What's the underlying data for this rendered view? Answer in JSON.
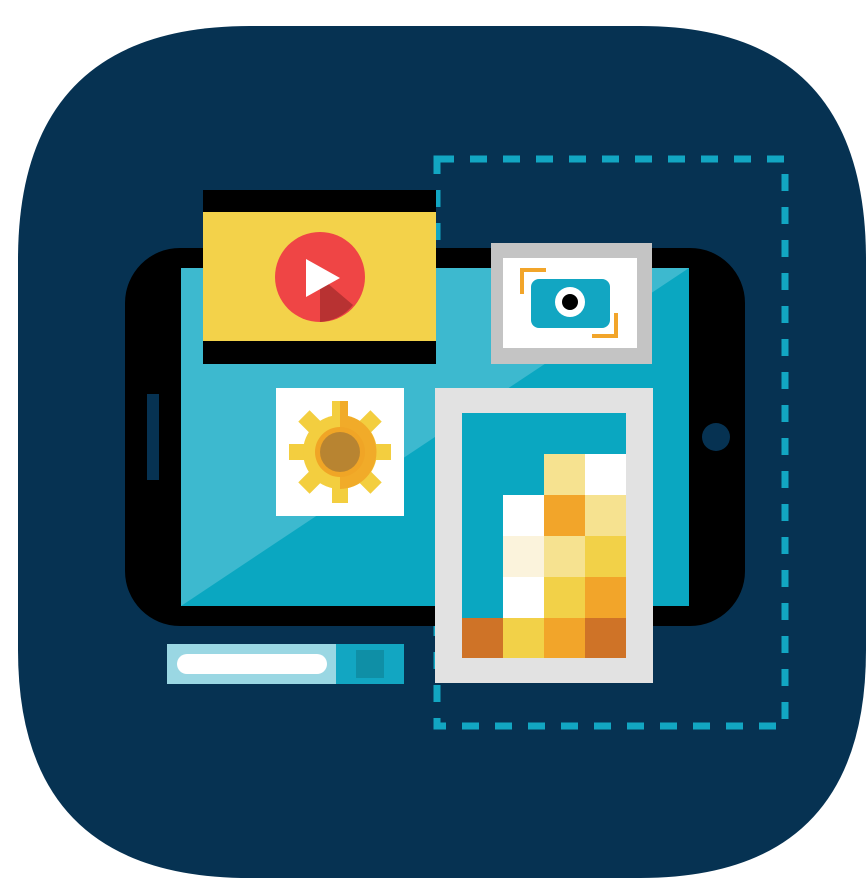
{
  "icon": {
    "name": "media-apps-tablet-app-icon",
    "elements": [
      "video-player-card",
      "play-icon",
      "camera-card",
      "camera-icon",
      "gear-icon",
      "photo-gallery-card",
      "pixel-mosaic",
      "search-bar",
      "dashed-selection-box",
      "tablet-device"
    ]
  },
  "colors": {
    "background_tile": "#063252",
    "tablet_body": "#000000",
    "screen_light": "#3db9cf",
    "screen_dark": "#0aa7c1",
    "accent_cyan": "#12a6c2",
    "video_yellow": "#f3d24a",
    "play_red": "#ef4545",
    "play_red_shadow": "#b83232",
    "camera_frame_grey": "#c4c4c4",
    "gear_light": "#f3ce3f",
    "gear_dark": "#f0a526",
    "gear_hub": "#b88431",
    "photo_frame": "#e2e2e2",
    "mosaic_orange": "#cf7327",
    "mosaic_amber": "#f2a52a",
    "mosaic_yellow": "#f2d148",
    "mosaic_pale": "#f6e290",
    "mosaic_cream": "#fbf3dc",
    "search_bar_light": "#9ad7e3",
    "search_field": "#ffffff",
    "search_button": "#0f8fa6"
  }
}
